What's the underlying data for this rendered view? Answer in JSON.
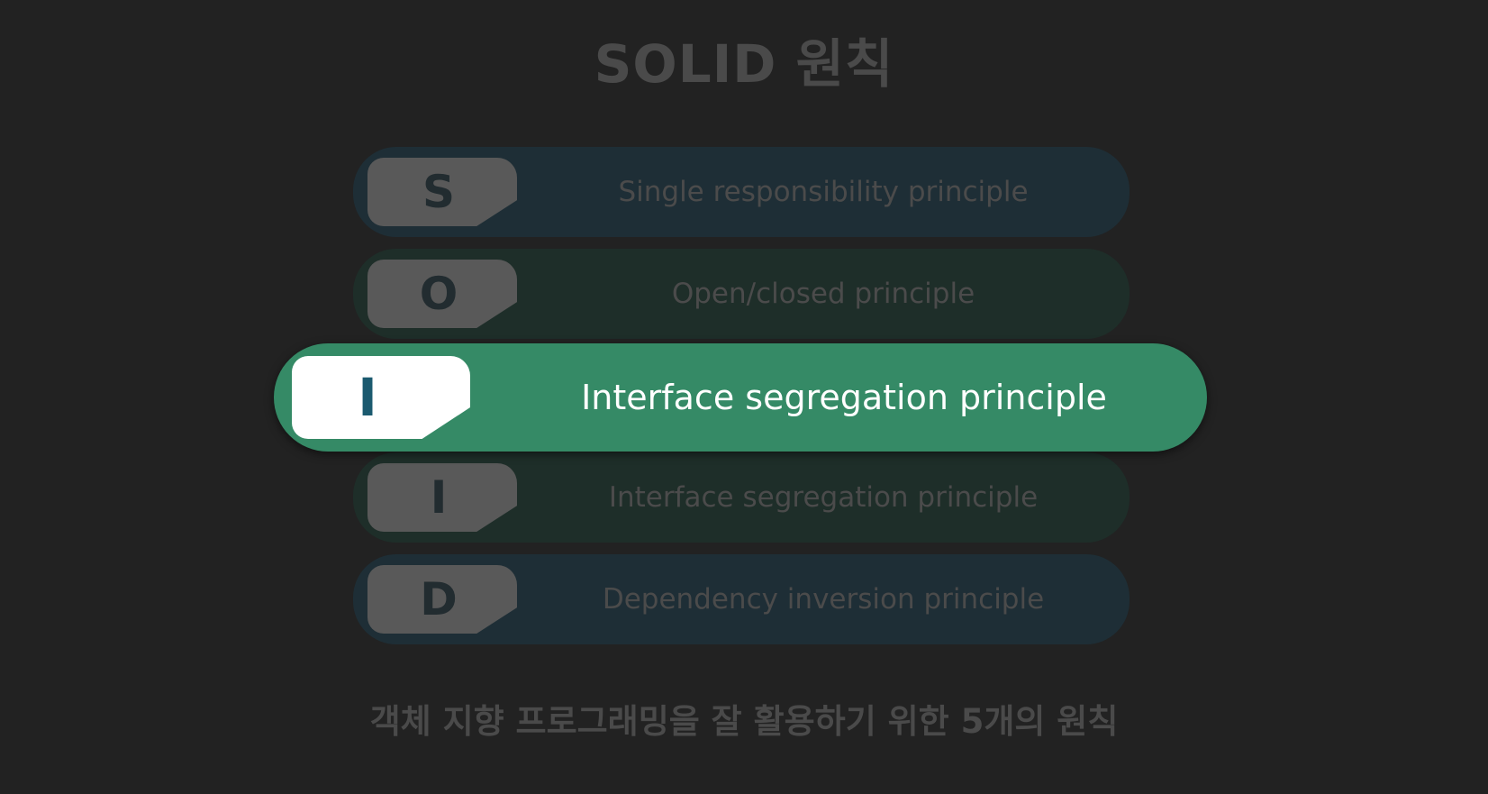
{
  "title": "SOLID 원칙",
  "principles": [
    {
      "letter": "S",
      "label": "Single responsibility principle"
    },
    {
      "letter": "O",
      "label": "Open/closed principle"
    },
    {
      "letter": "I",
      "label": "Interface segregation principle"
    },
    {
      "letter": "I",
      "label": "Interface segregation principle"
    },
    {
      "letter": "D",
      "label": "Dependency inversion principle"
    }
  ],
  "subtitle": "객체 지향 프로그래밍을 잘 활용하기 위한 5개의 원칙",
  "colors": {
    "background": "#222222",
    "active_row": "#358a66",
    "active_letter": "#1b5a6f",
    "dim_text": "#4b4b4b"
  }
}
